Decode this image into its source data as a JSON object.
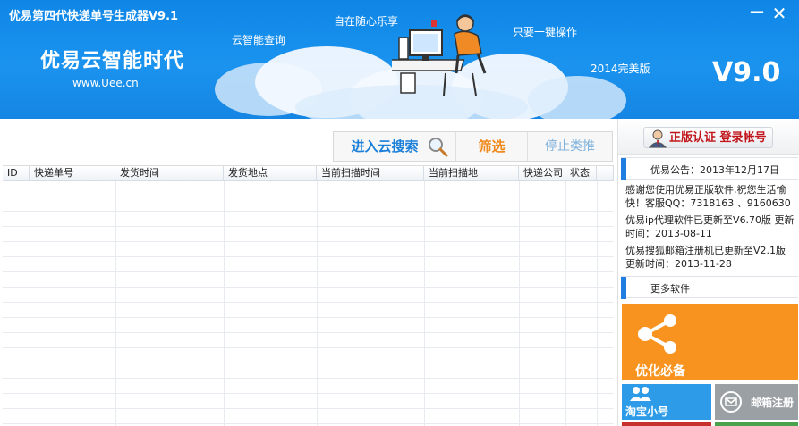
{
  "window": {
    "title": "优易第四代快递单号生成器V9.1",
    "minimize_label": "—",
    "close_label": "✕"
  },
  "banner": {
    "slogan": "优易云智能时代",
    "url": "www.Uee.cn",
    "tagline_cloud": "云智能查询",
    "tagline_free": "自在随心乐享",
    "tagline_oneclick": "只要一键操作",
    "tagline_edition": "2014完美版",
    "version": "V9.0"
  },
  "toolbar": {
    "search_label": "进入云搜索",
    "filter_label": "筛选",
    "stop_label": "停止类推"
  },
  "table": {
    "columns": [
      "ID",
      "快递单号",
      "发货时间",
      "发货地点",
      "当前扫描时间",
      "当前扫描地",
      "快递公司",
      "状态",
      ""
    ],
    "rows": []
  },
  "sidebar": {
    "auth_button": "正版认证 登录帐号",
    "notice_header": "优易公告：2013年12月17日",
    "notices": [
      "感谢您使用优易正版软件,祝您生活愉快！客服QQ：7318163 、9160630",
      "优易ip代理软件已更新至V6.70版 更新时间：2013-08-11",
      "优易搜狐邮箱注册机已更新至V2.1版 更新时间：2013-11-28"
    ],
    "more_header": "更多软件",
    "tiles": {
      "optimize": "优化必备",
      "taobao": "淘宝小号",
      "mail": "邮箱注册"
    }
  },
  "colors": {
    "banner_blue": "#1a93ef",
    "tile_orange": "#f7931e",
    "tile_blue": "#2d9be8",
    "tile_gray": "#9aa0a4",
    "auth_red": "#c0161c"
  }
}
